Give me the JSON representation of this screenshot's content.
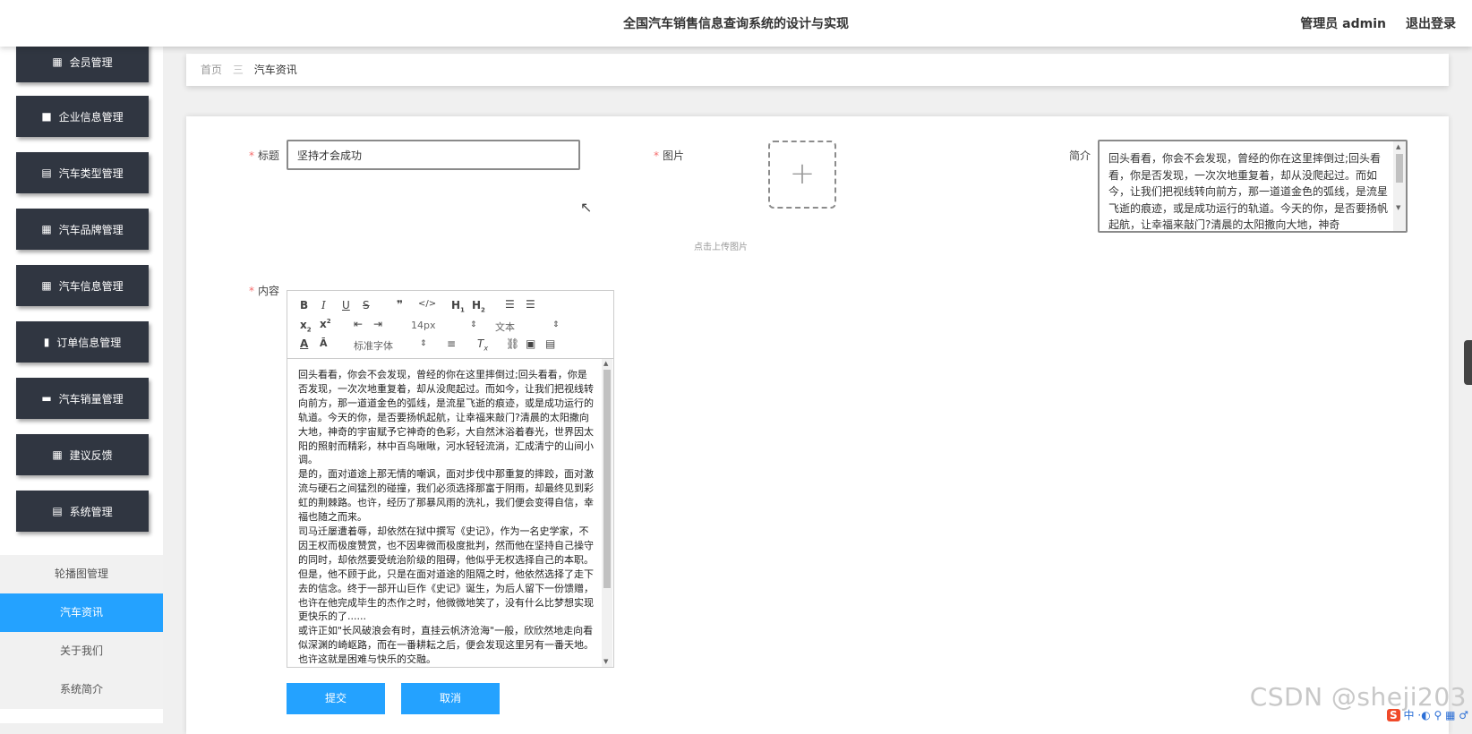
{
  "header": {
    "title": "全国汽车销售信息查询系统的设计与实现",
    "user_label": "管理员 admin",
    "logout_label": "退出登录"
  },
  "sidebar": {
    "menus": [
      {
        "label": "会员管理",
        "icon": "grid-icon"
      },
      {
        "label": "企业信息管理",
        "icon": "briefcase-icon"
      },
      {
        "label": "汽车类型管理",
        "icon": "clipboard-icon"
      },
      {
        "label": "汽车品牌管理",
        "icon": "grid-icon"
      },
      {
        "label": "汽车信息管理",
        "icon": "grid-icon"
      },
      {
        "label": "订单信息管理",
        "icon": "bar-chart-icon"
      },
      {
        "label": "汽车销量管理",
        "icon": "monitor-icon"
      },
      {
        "label": "建议反馈",
        "icon": "grid-icon"
      },
      {
        "label": "系统管理",
        "icon": "clipboard-icon"
      }
    ],
    "submenu": [
      {
        "label": "轮播图管理"
      },
      {
        "label": "汽车资讯",
        "active": true
      },
      {
        "label": "关于我们"
      },
      {
        "label": "系统简介"
      }
    ]
  },
  "breadcrumb": {
    "home": "首页",
    "separator": "三",
    "current": "汽车资讯"
  },
  "form": {
    "title_label": "标题",
    "title_value": "坚持才会成功",
    "image_label": "图片",
    "upload_tip": "点击上传图片",
    "intro_label": "简介",
    "intro_text": "回头看看，你会不会发现，曾经的你在这里摔倒过;回头看看，你是否发现，一次次地重复着，却从没爬起过。而如今，让我们把视线转向前方，那一道道金色的弧线，是流星飞逝的痕迹，或是成功运行的轨道。今天的你，是否要扬帆起航，让幸福来敲门?清晨的太阳撒向大地，神奇",
    "content_label": "内容",
    "editor_toolbar": {
      "font_size": "14px",
      "block_format": "文本",
      "font_family": "标准字体"
    },
    "content_paragraphs": [
      "回头看看，你会不会发现，曾经的你在这里摔倒过;回头看看，你是否发现，一次次地重复着，却从没爬起过。而如今，让我们把视线转向前方，那一道道金色的弧线，是流星飞逝的痕迹，或是成功运行的轨道。今天的你，是否要扬帆起航，让幸福来敲门?清晨的太阳撒向大地，神奇的宇宙赋予它神奇的色彩，大自然沐浴着春光，世界因太阳的照射而精彩，林中百鸟啾啾，河水轻轻流淌，汇成清宁的山间小调。",
      "是的，面对道途上那无情的嘲讽，面对步伐中那重复的摔跤，面对激流与硬石之间猛烈的碰撞，我们必须选择那富于阴雨，却最终见到彩虹的荆棘路。也许，经历了那暴风雨的洗礼，我们便会变得自信，幸福也随之而来。",
      "司马迁屡遭着辱，却依然在狱中撰写《史记》，作为一名史学家，不因王权而极度赞赏，也不因卑微而极度批判，然而他在坚持自己操守的同时，却依然要受统治阶级的阻碍，他似乎无权选择自己的本职。但是，他不顾于此，只是在面对道途的阻隔之时，他依然选择了走下去的信念。终于一部开山巨作《史记》诞生，为后人留下一份馈赠，也许在他完成毕生的杰作之时，他微微地笑了，没有什么比梦想实现更快乐的了......",
      "或许正如\"长风破浪会有时，直挂云帆济沧海\"一般，欣欣然地走向看似深渊的崎岖路，而在一番耕耘之后，便会发现这里另有一番天地。也许这就是困难与快乐的交融。"
    ],
    "submit_label": "提交",
    "cancel_label": "取消"
  },
  "watermark": "CSDN @sheji203",
  "ime": {
    "logo": "S",
    "label": "中"
  }
}
